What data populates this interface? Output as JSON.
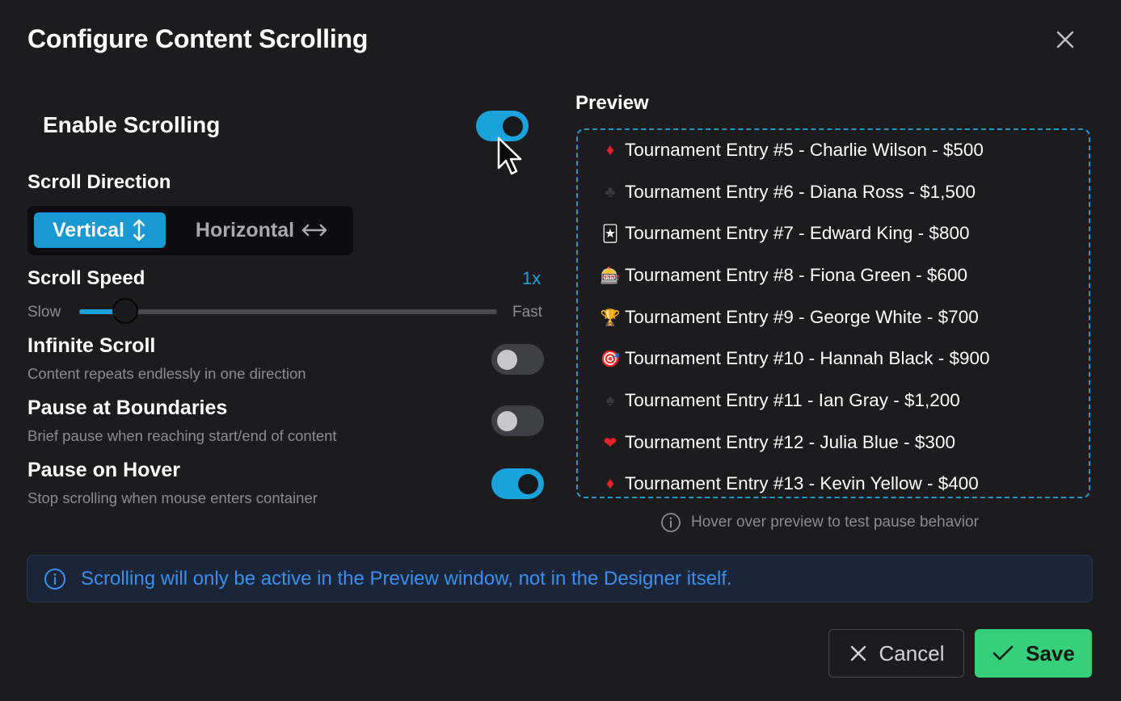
{
  "dialog": {
    "title": "Configure Content Scrolling"
  },
  "enable_scrolling": {
    "label": "Enable Scrolling",
    "enabled": true
  },
  "scroll_direction": {
    "label": "Scroll Direction",
    "options": [
      "Vertical",
      "Horizontal"
    ],
    "selected": "Vertical"
  },
  "scroll_speed": {
    "label": "Scroll Speed",
    "value": "1x",
    "min_label": "Slow",
    "max_label": "Fast",
    "level": 0.11
  },
  "options": [
    {
      "title": "Infinite Scroll",
      "description": "Content repeats endlessly in one direction",
      "enabled": false
    },
    {
      "title": "Pause at Boundaries",
      "description": "Brief pause when reaching start/end of content",
      "enabled": false
    },
    {
      "title": "Pause on Hover",
      "description": "Stop scrolling when mouse enters container",
      "enabled": true
    }
  ],
  "preview": {
    "label": "Preview",
    "entries": [
      {
        "icon": "♦",
        "text": "Tournament Entry #5 - Charlie Wilson - $500"
      },
      {
        "icon": "♣",
        "text": "Tournament Entry #6 - Diana Ross - $1,500"
      },
      {
        "icon": "🃏",
        "text": "Tournament Entry #7 - Edward King - $800"
      },
      {
        "icon": "🎰",
        "text": "Tournament Entry #8 - Fiona Green - $600"
      },
      {
        "icon": "🏆",
        "text": "Tournament Entry #9 - George White - $700"
      },
      {
        "icon": "🎯",
        "text": "Tournament Entry #10 - Hannah Black - $900"
      },
      {
        "icon": "♠",
        "text": "Tournament Entry #11 - Ian Gray - $1,200"
      },
      {
        "icon": "❤",
        "text": "Tournament Entry #12 - Julia Blue - $300"
      },
      {
        "icon": "♦",
        "text": "Tournament Entry #13 - Kevin Yellow - $400"
      }
    ],
    "hint": "Hover over preview to test pause behavior"
  },
  "banner": {
    "text": "Scrolling will only be active in the Preview window, not in the Designer itself."
  },
  "footer": {
    "cancel_label": "Cancel",
    "save_label": "Save"
  },
  "colors": {
    "accent": "#1aa3db",
    "save": "#36d07c",
    "info": "#3b8ff0",
    "background": "#1c1c1f"
  }
}
